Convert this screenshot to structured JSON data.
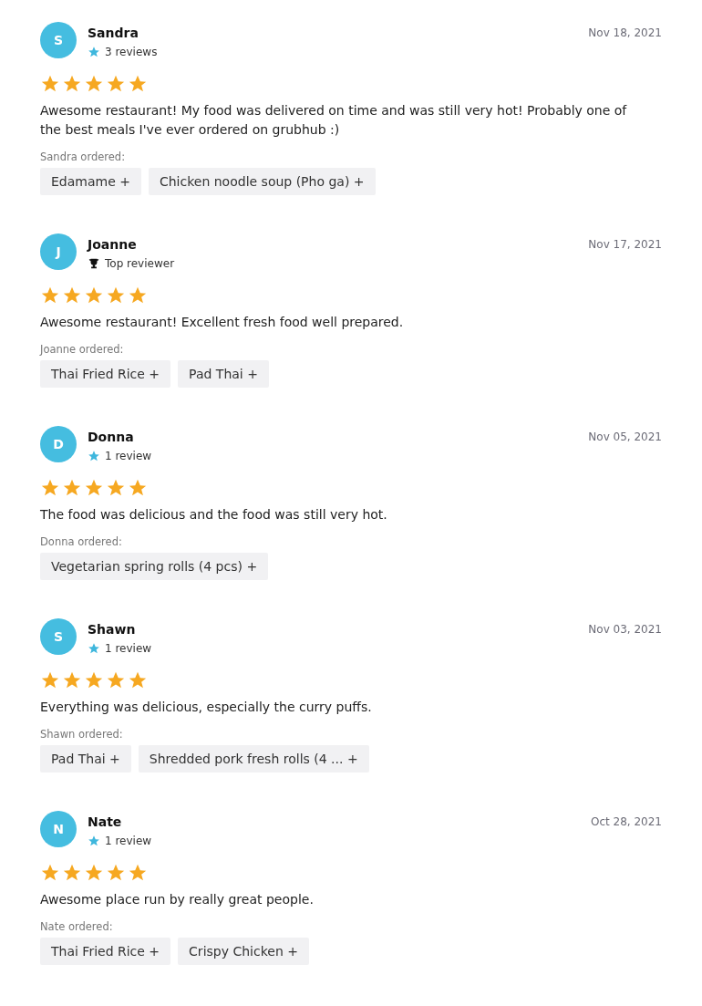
{
  "reviews": [
    {
      "initial": "S",
      "name": "Sandra",
      "badge": {
        "kind": "reviews",
        "text": "3 reviews"
      },
      "date": "Nov 18, 2021",
      "stars": 5,
      "text": "Awesome restaurant! My food was delivered on time and was still very hot! Probably one of the best meals I've ever ordered on grubhub :)",
      "ordered_label": "Sandra ordered:",
      "items": [
        "Edamame +",
        "Chicken noodle soup (Pho ga) +"
      ]
    },
    {
      "initial": "J",
      "name": "Joanne",
      "badge": {
        "kind": "top",
        "text": "Top reviewer"
      },
      "date": "Nov 17, 2021",
      "stars": 5,
      "text": "Awesome restaurant! Excellent fresh food well prepared.",
      "ordered_label": "Joanne ordered:",
      "items": [
        "Thai Fried Rice +",
        "Pad Thai +"
      ]
    },
    {
      "initial": "D",
      "name": "Donna",
      "badge": {
        "kind": "reviews",
        "text": "1 review"
      },
      "date": "Nov 05, 2021",
      "stars": 5,
      "text": "The food was delicious and the food was still very hot.",
      "ordered_label": "Donna ordered:",
      "items": [
        "Vegetarian spring rolls (4 pcs) +"
      ]
    },
    {
      "initial": "S",
      "name": "Shawn",
      "badge": {
        "kind": "reviews",
        "text": "1 review"
      },
      "date": "Nov 03, 2021",
      "stars": 5,
      "text": "Everything was delicious, especially the curry puffs.",
      "ordered_label": "Shawn ordered:",
      "items": [
        "Pad Thai +",
        "Shredded pork fresh rolls (4 ... +"
      ]
    },
    {
      "initial": "N",
      "name": "Nate",
      "badge": {
        "kind": "reviews",
        "text": "1 review"
      },
      "date": "Oct 28, 2021",
      "stars": 5,
      "text": "Awesome place run by really great people.",
      "ordered_label": "Nate ordered:",
      "items": [
        "Thai Fried Rice +",
        "Crispy Chicken +"
      ]
    }
  ]
}
